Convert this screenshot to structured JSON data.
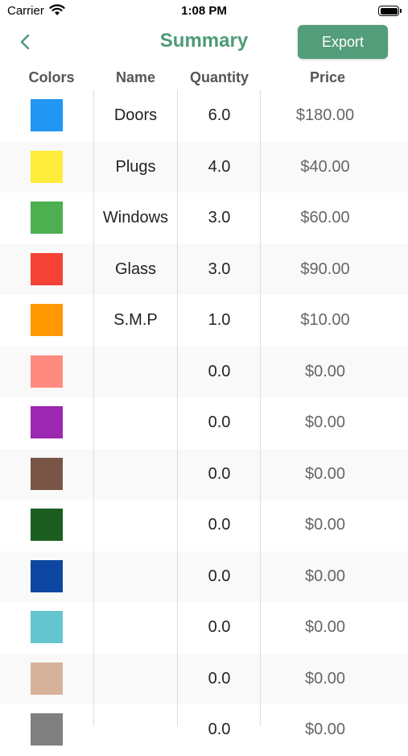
{
  "status": {
    "carrier": "Carrier",
    "time": "1:08 PM"
  },
  "nav": {
    "title": "Summary",
    "export_label": "Export"
  },
  "header": {
    "colors": "Colors",
    "name": "Name",
    "quantity": "Quantity",
    "price": "Price"
  },
  "rows": [
    {
      "color": "#2196F3",
      "name": "Doors",
      "quantity": "6.0",
      "price": "$180.00"
    },
    {
      "color": "#FFEB3B",
      "name": "Plugs",
      "quantity": "4.0",
      "price": "$40.00"
    },
    {
      "color": "#4CAF50",
      "name": "Windows",
      "quantity": "3.0",
      "price": "$60.00"
    },
    {
      "color": "#F44336",
      "name": "Glass",
      "quantity": "3.0",
      "price": "$90.00"
    },
    {
      "color": "#FF9800",
      "name": "S.M.P",
      "quantity": "1.0",
      "price": "$10.00"
    },
    {
      "color": "#FF8A80",
      "name": "",
      "quantity": "0.0",
      "price": "$0.00"
    },
    {
      "color": "#9C27B0",
      "name": "",
      "quantity": "0.0",
      "price": "$0.00"
    },
    {
      "color": "#795548",
      "name": "",
      "quantity": "0.0",
      "price": "$0.00"
    },
    {
      "color": "#1B5E20",
      "name": "",
      "quantity": "0.0",
      "price": "$0.00"
    },
    {
      "color": "#0D47A1",
      "name": "",
      "quantity": "0.0",
      "price": "$0.00"
    },
    {
      "color": "#64C4D0",
      "name": "",
      "quantity": "0.0",
      "price": "$0.00"
    },
    {
      "color": "#D7B29A",
      "name": "",
      "quantity": "0.0",
      "price": "$0.00"
    },
    {
      "color": "#808080",
      "name": "",
      "quantity": "0.0",
      "price": "$0.00"
    }
  ]
}
